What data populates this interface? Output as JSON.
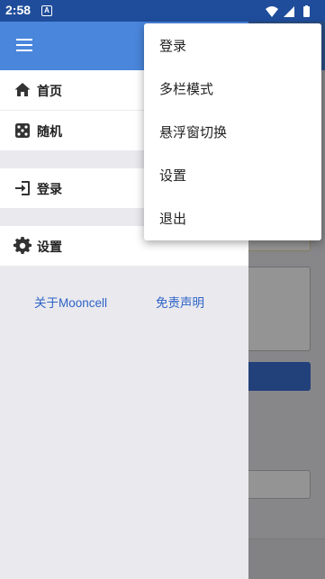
{
  "status_bar": {
    "time": "2:58",
    "notification_icon": "A",
    "icons": [
      "wifi-icon",
      "cellular-icon",
      "battery-icon"
    ]
  },
  "drawer": {
    "menu_icon": "hamburger-icon",
    "items": [
      {
        "label": "首页",
        "icon": "home-icon"
      },
      {
        "label": "随机",
        "icon": "dice-icon"
      },
      {
        "label": "登录",
        "icon": "login-icon"
      },
      {
        "label": "设置",
        "icon": "gear-icon"
      }
    ],
    "links": [
      "关于Mooncell",
      "免责声明"
    ]
  },
  "popup_menu": {
    "items": [
      "登录",
      "多栏模式",
      "悬浮窗切换",
      "设置",
      "退出"
    ]
  },
  "colors": {
    "status_bar": "#1f4d9b",
    "app_bar": "#4a86dc",
    "link": "#2e63c7",
    "drawer_bg": "#e9e9ee"
  }
}
